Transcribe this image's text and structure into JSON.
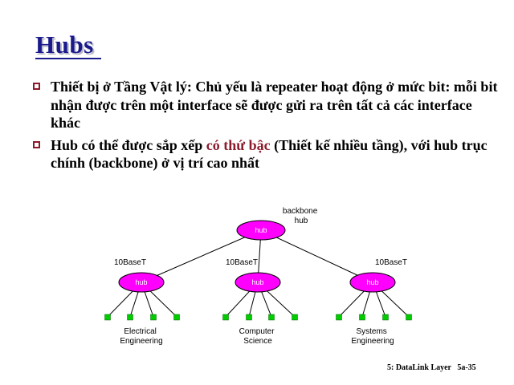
{
  "title": "Hubs",
  "bullets": [
    {
      "text": "Thiết bị ở Tầng Vật lý: Chủ yếu là repeater hoạt động ở mức bit: mỗi bit nhận được trên một interface sẽ được gửi ra trên tất cả các interface khác"
    },
    {
      "before": "Hub có thể được sắp xếp ",
      "highlight": "có thứ bậc",
      "after": " (Thiết kế nhiều tầng), với hub trục chính (backbone) ở vị trí cao nhất"
    }
  ],
  "diagram": {
    "backbone_label_line1": "backbone",
    "backbone_label_line2": "hub",
    "backbone_hub_label": "hub",
    "hub_color": "#ff00ff",
    "host_color": "#00cc00",
    "groups": [
      {
        "link_label": "10BaseT",
        "hub_label": "hub",
        "dept_line1": "Electrical",
        "dept_line2": "Engineering"
      },
      {
        "link_label": "10BaseT",
        "hub_label": "hub",
        "dept_line1": "Computer",
        "dept_line2": "Science"
      },
      {
        "link_label": "10BaseT",
        "hub_label": "hub",
        "dept_line1": "Systems",
        "dept_line2": "Engineering"
      }
    ]
  },
  "footer": {
    "chapter": "5: DataLink Layer",
    "page": "5a-35"
  }
}
